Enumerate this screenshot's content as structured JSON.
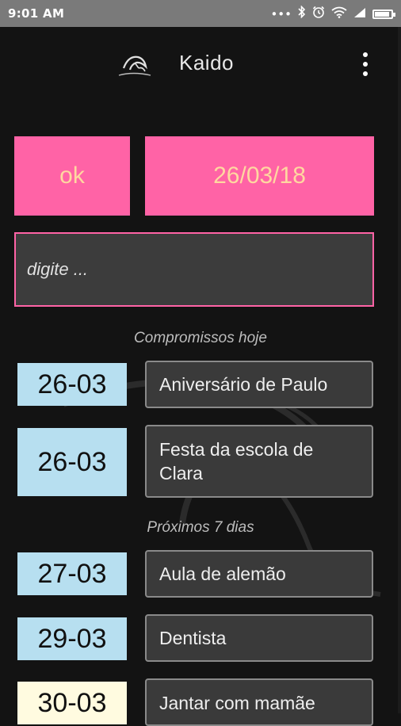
{
  "status_bar": {
    "time": "9:01 AM",
    "icons": [
      "more-dots-icon",
      "bluetooth-icon",
      "alarm-icon",
      "wifi-icon",
      "signal-icon",
      "battery-icon"
    ],
    "battery_level": 0.8
  },
  "app_bar": {
    "title": "Kaido",
    "logo": "dragon-logo-icon",
    "menu": "overflow-menu-icon"
  },
  "actions": {
    "ok_label": "ok",
    "date_label": "26/03/18"
  },
  "entry": {
    "placeholder": "digite ..."
  },
  "today": {
    "heading": "Compromissos hoje",
    "items": [
      {
        "date": "26-03",
        "text": "Aniversário de Paulo"
      },
      {
        "date": "26-03",
        "text": "Festa da escola de Clara"
      }
    ]
  },
  "next_days": {
    "heading": "Próximos 7 dias",
    "items": [
      {
        "date": "27-03",
        "text": "Aula de alemão"
      },
      {
        "date": "29-03",
        "text": "Dentista"
      },
      {
        "date": "30-03",
        "text": "Jantar com mamãe"
      }
    ]
  },
  "colors": {
    "accent_pink": "#ff63a6",
    "accent_text": "#ffd7a0",
    "date_blue": "#b7dff0",
    "date_cream": "#fffbe0",
    "background": "#131313"
  }
}
